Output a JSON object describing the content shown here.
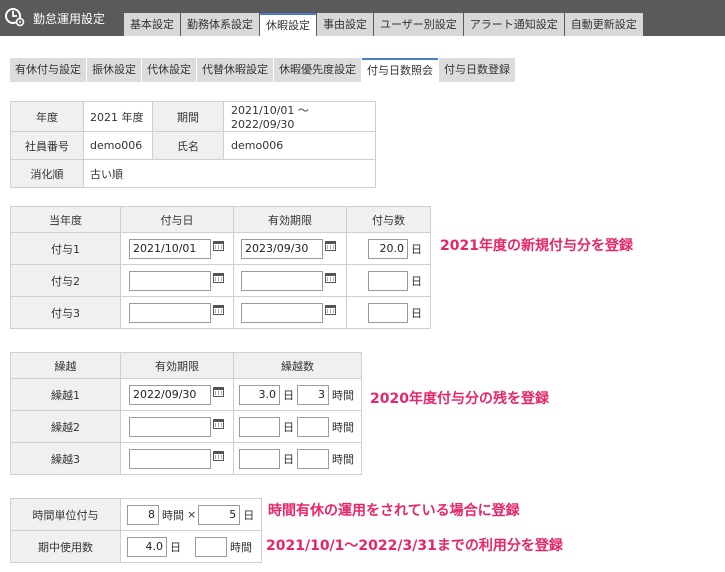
{
  "header": {
    "title": "勤怠運用設定"
  },
  "main_tabs": [
    {
      "label": "基本設定"
    },
    {
      "label": "勤務体系設定"
    },
    {
      "label": "休暇設定"
    },
    {
      "label": "事由設定"
    },
    {
      "label": "ユーザー別設定"
    },
    {
      "label": "アラート通知設定"
    },
    {
      "label": "自動更新設定"
    }
  ],
  "sub_tabs": [
    {
      "label": "有休付与設定"
    },
    {
      "label": "振休設定"
    },
    {
      "label": "代休設定"
    },
    {
      "label": "代替休暇設定"
    },
    {
      "label": "休暇優先度設定"
    },
    {
      "label": "付与日数照会"
    },
    {
      "label": "付与日数登録"
    }
  ],
  "info": {
    "year_label": "年度",
    "year_value": "2021 年度",
    "period_label": "期間",
    "period_value": "2021/10/01 ～ 2022/09/30",
    "emp_label": "社員番号",
    "emp_value": "demo006",
    "name_label": "氏名",
    "name_value": "demo006",
    "order_label": "消化順",
    "order_value": "古い順"
  },
  "grant": {
    "headers": [
      "当年度",
      "付与日",
      "有効期限",
      "付与数"
    ],
    "unit": "日",
    "rows": [
      {
        "label": "付与1",
        "date": "2021/10/01",
        "expiry": "2023/09/30",
        "count": "20.0"
      },
      {
        "label": "付与2",
        "date": "",
        "expiry": "",
        "count": ""
      },
      {
        "label": "付与3",
        "date": "",
        "expiry": "",
        "count": ""
      }
    ]
  },
  "carry": {
    "headers": [
      "繰越",
      "有効期限",
      "繰越数"
    ],
    "day_unit": "日",
    "hour_unit": "時間",
    "rows": [
      {
        "label": "繰越1",
        "expiry": "2022/09/30",
        "days": "3.0",
        "hours": "3"
      },
      {
        "label": "繰越2",
        "expiry": "",
        "days": "",
        "hours": ""
      },
      {
        "label": "繰越3",
        "expiry": "",
        "days": "",
        "hours": ""
      }
    ]
  },
  "hourly": {
    "unit_label": "時間単位付与",
    "hours": "8",
    "hour_unit": "時間",
    "times": "×",
    "days": "5",
    "day_unit": "日",
    "used_label": "期中使用数",
    "used_days": "4.0",
    "used_day_unit": "日",
    "used_hours": "",
    "used_hour_unit": "時間"
  },
  "annotations": {
    "a1": "2021年度の新規付与分を登録",
    "a2": "2020年度付与分の残を登録",
    "a3": "時間有休の運用をされている場合に登録",
    "a4": "2021/10/1～2022/3/31までの利用分を登録"
  },
  "colors": {
    "accent": "#4a7cc4",
    "annotation": "#e8256a",
    "header_bg": "#5a5a5a"
  }
}
